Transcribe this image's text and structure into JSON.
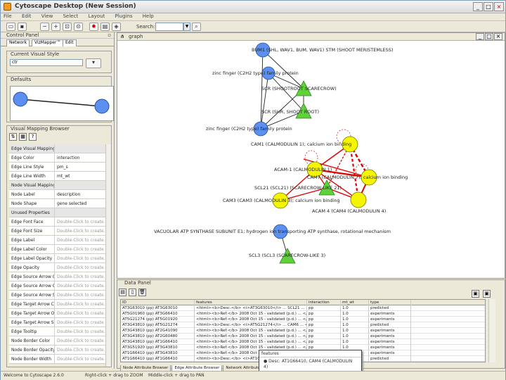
{
  "window": {
    "title": "Cytoscape Desktop (New Session)"
  },
  "menu": [
    "File",
    "Edit",
    "View",
    "Select",
    "Layout",
    "Plugins",
    "Help"
  ],
  "toolbar": {
    "search_label": "Search:",
    "search_value": ""
  },
  "control_panel": {
    "title": "Control Panel",
    "tabs": [
      "Network",
      "VizMapper™",
      "Edit"
    ],
    "current_style_title": "Current Visual Style",
    "current_style_value": "ctr",
    "defaults_title": "Defaults",
    "mapping_browser_title": "Visual Mapping Browser",
    "rows": [
      {
        "label": "Edge Visual Mapping",
        "value": "",
        "group": true
      },
      {
        "label": "Edge Color",
        "value": "interaction",
        "group": false
      },
      {
        "label": "Edge Line Style",
        "value": "pm_s",
        "group": false
      },
      {
        "label": "Edge Line Width",
        "value": "mt_wt",
        "group": false
      },
      {
        "label": "Node Visual Mapping",
        "value": "",
        "group": true
      },
      {
        "label": "Node Label",
        "value": "description",
        "group": false
      },
      {
        "label": "Node Shape",
        "value": "gene selected",
        "group": false
      },
      {
        "label": "Unused Properties",
        "value": "",
        "group": true
      },
      {
        "label": "Edge Font Face",
        "value": "Double-Click to create...",
        "group": false
      },
      {
        "label": "Edge Font Size",
        "value": "Double-Click to create...",
        "group": false
      },
      {
        "label": "Edge Label",
        "value": "Double-Click to create...",
        "group": false
      },
      {
        "label": "Edge Label Color",
        "value": "Double-Click to create...",
        "group": false
      },
      {
        "label": "Edge Label Opacity",
        "value": "Double-Click to create...",
        "group": false
      },
      {
        "label": "Edge Opacity",
        "value": "Double-Click to create...",
        "group": false
      },
      {
        "label": "Edge Source Arrow Color",
        "value": "Double-Click to create...",
        "group": false
      },
      {
        "label": "Edge Source Arrow Opacity",
        "value": "Double-Click to create...",
        "group": false
      },
      {
        "label": "Edge Source Arrow Shape",
        "value": "Double-Click to create...",
        "group": false
      },
      {
        "label": "Edge Target Arrow Color",
        "value": "Double-Click to create...",
        "group": false
      },
      {
        "label": "Edge Target Arrow Opacity",
        "value": "Double-Click to create...",
        "group": false
      },
      {
        "label": "Edge Target Arrow Shape",
        "value": "Double-Click to create...",
        "group": false
      },
      {
        "label": "Edge Tooltip",
        "value": "Double-Click to create...",
        "group": false
      },
      {
        "label": "Node Border Color",
        "value": "Double-Click to create...",
        "group": false
      },
      {
        "label": "Node Border Opacity",
        "value": "Double-Click to create...",
        "group": false
      },
      {
        "label": "Node Border Width",
        "value": "Double-Click to create...",
        "group": false
      }
    ]
  },
  "network": {
    "title": "graph",
    "colors": {
      "blue": "#5b8ff0",
      "yellow": "#f5f500",
      "green": "#5fd23a",
      "red": "#dd0000",
      "edge": "#222222"
    },
    "labels": [
      "BUM1 (SHL, WAV1, BUM, WAV1) STM (SHOOT MERISTEMLESS)",
      "zinc finger (C2H2 type) family protein",
      "SCR (SHOOTROOT SCARECROW)",
      "SCR (SHR, SHOOT ROOT)",
      "zinc finger (C2H2 type) family protein",
      "CAM1 (CALMODULIN 1); calcium ion binding",
      "ACAM-1 (CALMODULIN 1)",
      "CAM7 (CALMODULIN 7); calcium ion binding",
      "SCL21 (SCL21) (SCARECROW-LIKE 21)",
      "CAM3 (CAM3 (CALMODULIN 3); calcium ion binding",
      "ACAM 4 (CAM4 (CALMODULIN 4)",
      "VACUOLAR ATP SYNTHASE SUBUNIT E1; hydrogen ion transporting ATP synthase, rotational mechanism",
      "SCL3 (SCL3 (SCARECROW-LIKE 3)"
    ]
  },
  "data_panel": {
    "title": "Data Panel",
    "columns": [
      "ID",
      "features",
      "interaction",
      "mt_wt",
      "type"
    ],
    "rows": [
      [
        "AT3G63010 (pp) AT3G63010",
        "<html><b>Desc:</b> <i>AT3G63010</i> ... SCL21 ... </html>",
        "pp",
        "1.0",
        "predicted"
      ],
      [
        "AT5G01960 (pp) AT3G66410",
        "<html><b>Ref:</b> 2008 Oct 15 - validated (p.d.) ... </html>",
        "pp",
        "1.0",
        "experiments"
      ],
      [
        "AT5G21274 (pp) AT5G01920",
        "<html><b>Ref:</b> 2008 Oct 15 - validated (p.d.) ... </html>",
        "pp",
        "1.0",
        "experiments"
      ],
      [
        "AT3G43810 (pp) AT5G21274",
        "<html><b>Desc:</b> <i>AT5G21274</i> ... CAM6 ... </html>",
        "pp",
        "1.0",
        "predicted"
      ],
      [
        "AT3G43810 (pp) AT2G41090",
        "<html><b>Ref:</b> 2008 Oct 15 - validated (p.d.) ... </html>",
        "pp",
        "1.0",
        "experiments"
      ],
      [
        "AT3G43810 (pp) AT2G60480",
        "<html><b>Ref:</b> 2008 Oct 15 - validated (p.d.) ... </html>",
        "pp",
        "1.0",
        "experiments"
      ],
      [
        "AT3G43810 (pp) AT1G66410",
        "<html><b>Ref:</b> 2008 Oct 15 - validated (p.d.) ... </html>",
        "pp",
        "1.0",
        "experiments"
      ],
      [
        "AT3G51920 (pp) AT3G43810",
        "<html><b>Ref:</b> 2008 Oct 15 - validated (p.d.) ... </html>",
        "pp",
        "1.0",
        "experiments"
      ],
      [
        "AT1G66410 (pp) AT3G43810",
        "<html><b>Ref:</b> 2008 Oct 15 - validated (p.d.) ... </html>",
        "pp",
        "1.0",
        "experiments"
      ],
      [
        "AT1G66410 (pp) AT1G66410",
        "<html><b>Desc:</b> <i>AT1G66410</i> ... CAM4 ... </html>",
        "pp",
        "1.0",
        "predicted"
      ]
    ],
    "tabs": [
      "Node Attribute Browser",
      "Edge Attribute Browser",
      "Network Attribute Browser"
    ],
    "tooltip_title": "features",
    "tooltip_text": "Desc: AT1G66410, CAM4 (CALMODULIN 4)"
  },
  "status": {
    "left": "Welcome to Cytoscape 2.6.0",
    "middle": "Right-click + drag to ZOOM",
    "right": "Middle-click + drag to PAN"
  }
}
